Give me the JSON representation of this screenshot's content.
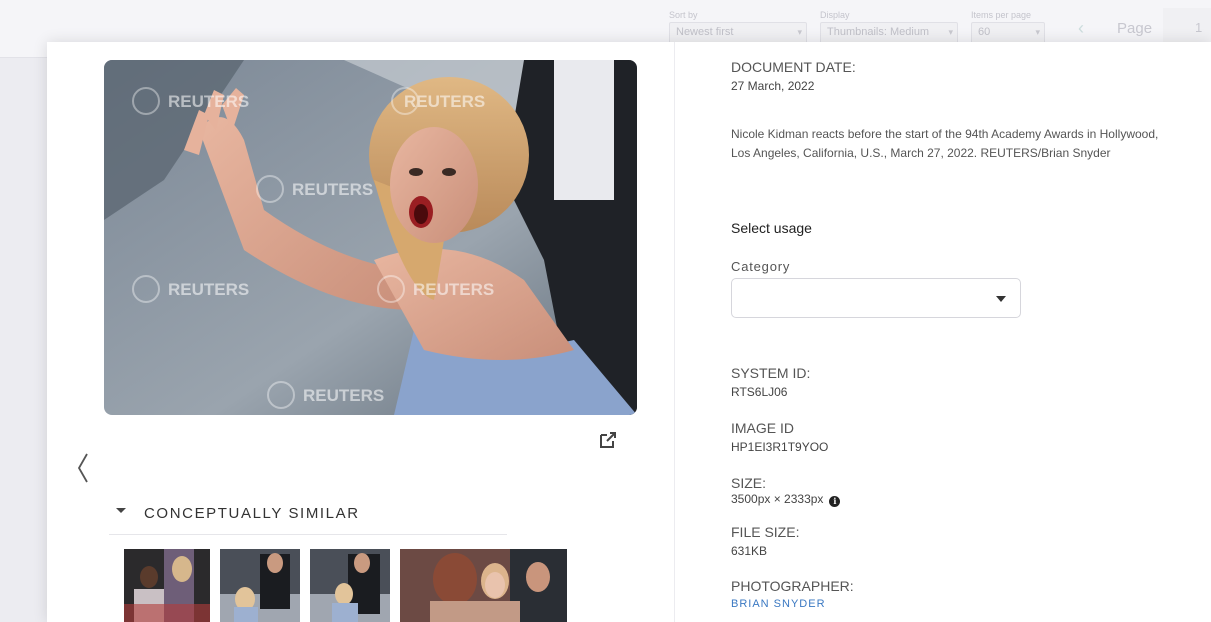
{
  "background_toolbar": {
    "sort_label": "Sort by",
    "sort_value": "Newest first",
    "display_label": "Display",
    "display_value": "Thumbnails: Medium",
    "per_page_label": "Items per page",
    "per_page_value": "60",
    "page_label": "Page",
    "page_number": "1"
  },
  "image": {
    "watermark": "REUTERS"
  },
  "similar": {
    "title": "CONCEPTUALLY SIMILAR"
  },
  "details": {
    "document_date_label": "DOCUMENT DATE:",
    "document_date_value": "27 March, 2022",
    "caption": "Nicole Kidman reacts before the start of the 94th Academy Awards in Hollywood, Los Angeles, California, U.S., March 27, 2022. REUTERS/Brian Snyder",
    "select_usage": "Select usage",
    "category_label": "Category",
    "category_value": "",
    "system_id_label": "SYSTEM ID:",
    "system_id_value": "RTS6LJ06",
    "image_id_label": "IMAGE ID",
    "image_id_value": "HP1EI3R1T9YOO",
    "size_label": "SIZE:",
    "size_value": "3500px × 2333px",
    "file_size_label": "FILE SIZE:",
    "file_size_value": "631KB",
    "photographer_label": "PHOTOGRAPHER:",
    "photographer_value": "BRIAN SNYDER"
  },
  "colors": {
    "link": "#3a78c2",
    "modal_bg": "#ffffff",
    "page_bg": "#e9e9ef"
  },
  "icons": {
    "external_link": "external-link-icon",
    "previous": "chevron-left-icon",
    "info": "info-icon",
    "dropdown": "caret-down-icon"
  }
}
